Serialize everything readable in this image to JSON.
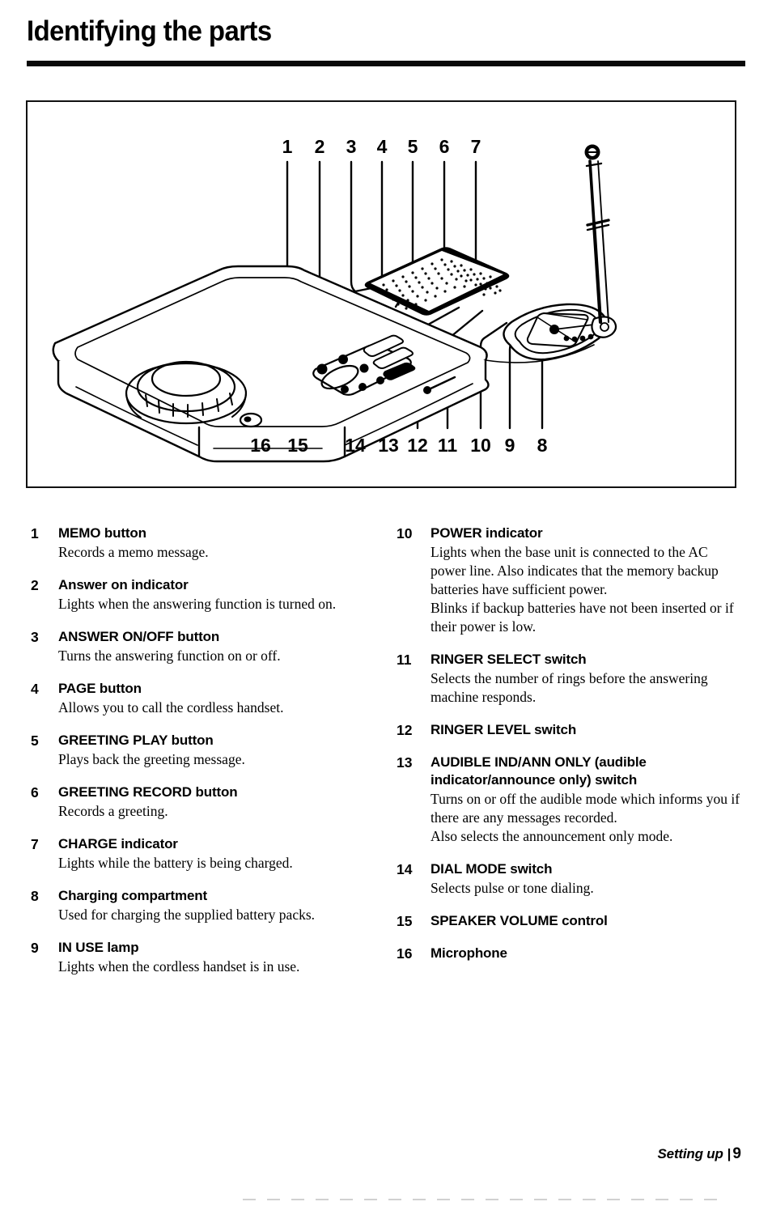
{
  "page": {
    "title": "Identifying the parts",
    "footer_section": "Setting up",
    "footer_separator": "|",
    "footer_page_number": "9"
  },
  "figure": {
    "caption": "",
    "device": "cordless telephone answering machine base unit",
    "callouts_top": [
      "1",
      "2",
      "3",
      "4",
      "5",
      "6",
      "7"
    ],
    "callouts_bottom": [
      "16",
      "15",
      "14",
      "13",
      "12",
      "11",
      "10",
      "9",
      "8"
    ]
  },
  "parts": {
    "left": [
      {
        "number": "1",
        "title": "MEMO button",
        "desc": [
          "Records a memo message."
        ]
      },
      {
        "number": "2",
        "title": "Answer on indicator",
        "desc": [
          "Lights when the answering function is turned on."
        ]
      },
      {
        "number": "3",
        "title": "ANSWER ON/OFF button",
        "desc": [
          "Turns the answering function on or off."
        ]
      },
      {
        "number": "4",
        "title": "PAGE button",
        "desc": [
          "Allows you to call the cordless handset."
        ]
      },
      {
        "number": "5",
        "title": "GREETING PLAY button",
        "desc": [
          "Plays back the greeting message."
        ]
      },
      {
        "number": "6",
        "title": "GREETING RECORD button",
        "desc": [
          "Records a greeting."
        ]
      },
      {
        "number": "7",
        "title": "CHARGE indicator",
        "desc": [
          "Lights while the battery is being charged."
        ]
      },
      {
        "number": "8",
        "title": "Charging compartment",
        "desc": [
          "Used for charging the supplied battery packs."
        ]
      },
      {
        "number": "9",
        "title": "IN USE lamp",
        "desc": [
          "Lights when the cordless handset is in use."
        ]
      }
    ],
    "right": [
      {
        "number": "10",
        "title": "POWER indicator",
        "desc": [
          "Lights when the base unit is connected to the AC power line. Also indicates that the memory backup batteries have sufficient power.",
          "Blinks if backup batteries have not been inserted or if their power is low."
        ]
      },
      {
        "number": "11",
        "title": "RINGER SELECT switch",
        "desc": [
          "Selects the number of rings before the answering machine responds."
        ]
      },
      {
        "number": "12",
        "title": "RINGER LEVEL switch",
        "desc": []
      },
      {
        "number": "13",
        "title": "AUDIBLE IND/ANN ONLY (audible indicator/announce only) switch",
        "desc": [
          "Turns on or off the audible mode which informs you if there are any messages recorded.",
          "Also selects the announcement only mode."
        ]
      },
      {
        "number": "14",
        "title": "DIAL MODE switch",
        "desc": [
          "Selects pulse or tone dialing."
        ]
      },
      {
        "number": "15",
        "title": "SPEAKER VOLUME control",
        "desc": []
      },
      {
        "number": "16",
        "title": "Microphone",
        "desc": []
      }
    ]
  }
}
